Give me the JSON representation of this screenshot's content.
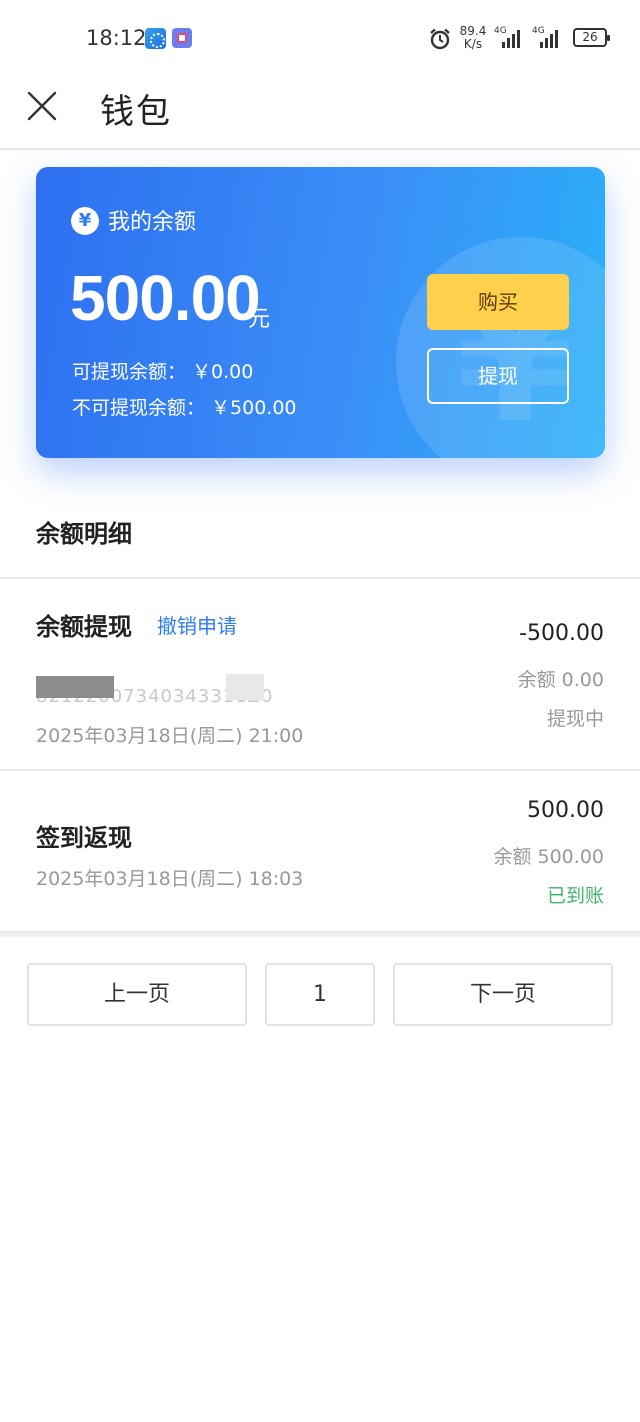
{
  "status_bar": {
    "time": "18:12",
    "net_speed_value": "89.4",
    "net_speed_unit": "K/s",
    "signal_label_1": "4G",
    "signal_label_2": "4G",
    "battery": "26"
  },
  "header": {
    "title": "钱包"
  },
  "balance_card": {
    "label": "我的余额",
    "amount": "500.00",
    "unit": "元",
    "withdrawable": "可提现余额： ￥0.00",
    "non_withdrawable": "不可提现余额： ￥500.00",
    "buy_label": "购买",
    "withdraw_label": "提现",
    "gradient_start": "#2d6ff0",
    "gradient_end": "#2ab0f8",
    "buy_color": "#ffd04c"
  },
  "details": {
    "title": "余额明细",
    "records": [
      {
        "title": "余额提现",
        "action": "撤销申请",
        "masked_text": "82122007340343311Z0",
        "date": "2025年03月18日(周二) 21:00",
        "amount": "-500.00",
        "balance": "余额 0.00",
        "status": "提现中",
        "status_color": "#999999"
      },
      {
        "title": "签到返现",
        "date": "2025年03月18日(周二) 18:03",
        "amount": "500.00",
        "balance": "余额 500.00",
        "status": "已到账",
        "status_color": "#3fb569"
      }
    ]
  },
  "pagination": {
    "prev_label": "上一页",
    "current_page": "1",
    "next_label": "下一页"
  }
}
